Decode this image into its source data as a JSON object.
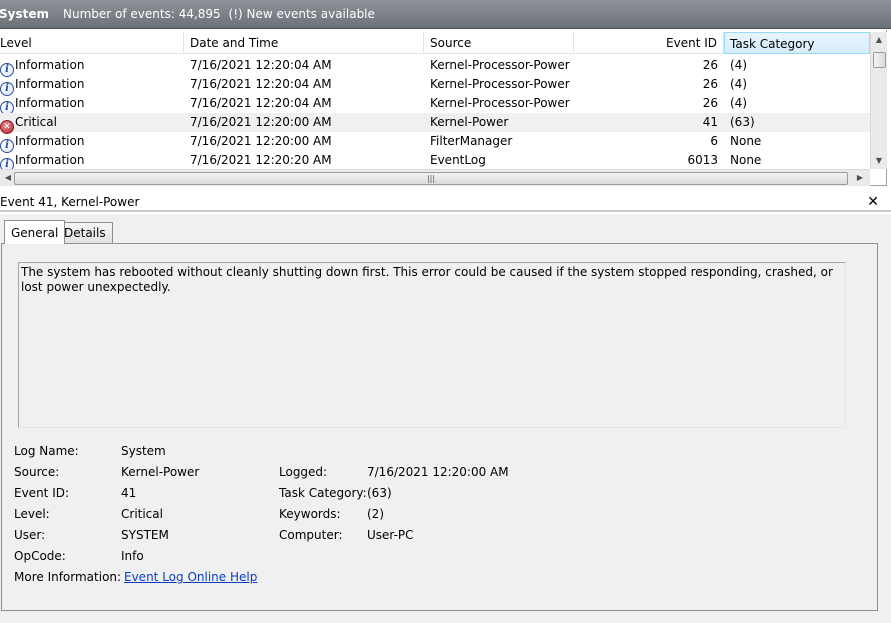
{
  "title_bar": {
    "log_name": "System",
    "event_count": "Number of events: 44,895",
    "new_events": "(!) New events available"
  },
  "columns": [
    "Level",
    "Date and Time",
    "Source",
    "Event ID",
    "Task Category"
  ],
  "rows": [
    {
      "level": "Information",
      "icon": "info-icon",
      "datetime": "7/16/2021 12:20:04 AM",
      "source": "Kernel-Processor-Power",
      "event_id": "26",
      "task_category": "(4)"
    },
    {
      "level": "Information",
      "icon": "info-icon",
      "datetime": "7/16/2021 12:20:04 AM",
      "source": "Kernel-Processor-Power",
      "event_id": "26",
      "task_category": "(4)"
    },
    {
      "level": "Information",
      "icon": "info-icon",
      "datetime": "7/16/2021 12:20:04 AM",
      "source": "Kernel-Processor-Power",
      "event_id": "26",
      "task_category": "(4)"
    },
    {
      "level": "Critical",
      "icon": "critical-icon",
      "datetime": "7/16/2021 12:20:00 AM",
      "source": "Kernel-Power",
      "event_id": "41",
      "task_category": "(63)"
    },
    {
      "level": "Information",
      "icon": "info-icon",
      "datetime": "7/16/2021 12:20:00 AM",
      "source": "FilterManager",
      "event_id": "6",
      "task_category": "None"
    },
    {
      "level": "Information",
      "icon": "info-icon",
      "datetime": "7/16/2021 12:20:20 AM",
      "source": "EventLog",
      "event_id": "6013",
      "task_category": "None"
    }
  ],
  "selected_row_index": 3,
  "detail": {
    "header": "Event 41, Kernel-Power",
    "tabs": [
      "General",
      "Details"
    ],
    "active_tab": "General",
    "description": "The system has rebooted without cleanly shutting down first. This error could be caused if the system stopped responding, crashed, or lost power unexpectedly.",
    "labels": {
      "log_name": "Log Name:",
      "source": "Source:",
      "event_id": "Event ID:",
      "level": "Level:",
      "user": "User:",
      "opcode": "OpCode:",
      "more_info": "More Information:",
      "logged": "Logged:",
      "task_category": "Task Category:",
      "keywords": "Keywords:",
      "computer": "Computer:"
    },
    "values": {
      "log_name": "System",
      "source": "Kernel-Power",
      "event_id": "41",
      "level": "Critical",
      "user": "SYSTEM",
      "opcode": "Info",
      "more_info_link": "Event Log Online Help",
      "logged": "7/16/2021 12:20:00 AM",
      "task_category": "(63)",
      "keywords": "(2)",
      "computer": "User-PC"
    }
  },
  "icons": {
    "close": "close-icon",
    "scroll_up": "scroll-up-icon",
    "scroll_down": "scroll-down-icon",
    "scroll_left": "scroll-left-icon",
    "scroll_right": "scroll-right-icon"
  },
  "colors": {
    "title_bar": "#7a7e84",
    "sorted_header": "#d4ecfb",
    "selected_row": "#f0f0f0",
    "link": "#0a3cc8",
    "critical": "#b3262d",
    "info": "#1d48a3"
  }
}
